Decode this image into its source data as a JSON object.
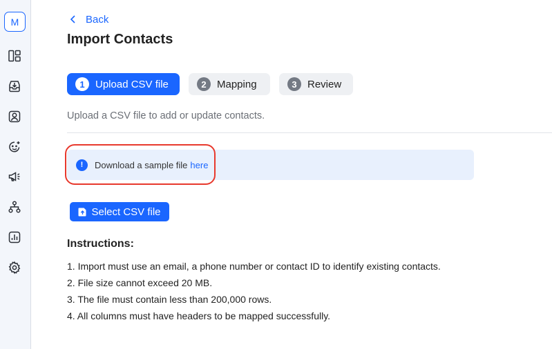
{
  "sidebar": {
    "avatar_letter": "M",
    "items": [
      {
        "icon": "dashboard-icon"
      },
      {
        "icon": "inbox-icon"
      },
      {
        "icon": "contacts-icon"
      },
      {
        "icon": "ai-assistant-icon"
      },
      {
        "icon": "megaphone-icon"
      },
      {
        "icon": "workflow-icon"
      },
      {
        "icon": "reports-icon"
      },
      {
        "icon": "settings-icon"
      }
    ]
  },
  "header": {
    "back_label": "Back",
    "title": "Import Contacts"
  },
  "steps": [
    {
      "number": "1",
      "label": "Upload CSV file",
      "active": true
    },
    {
      "number": "2",
      "label": "Mapping",
      "active": false
    },
    {
      "number": "3",
      "label": "Review",
      "active": false
    }
  ],
  "subtitle": "Upload a CSV file to add or update contacts.",
  "banner": {
    "icon_glyph": "!",
    "text": "Download a sample file",
    "link": "here"
  },
  "select_button_label": "Select CSV file",
  "instructions": {
    "title": "Instructions:",
    "items": [
      "1. Import must use an email, a phone number or contact ID to identify existing contacts.",
      "2. File size cannot exceed 20 MB.",
      "3. The file must contain less than 200,000 rows.",
      "4. All columns must have headers to be mapped successfully."
    ]
  },
  "colors": {
    "accent": "#1a66ff",
    "highlight": "#e8382c",
    "banner_bg": "#e8f0fd"
  }
}
